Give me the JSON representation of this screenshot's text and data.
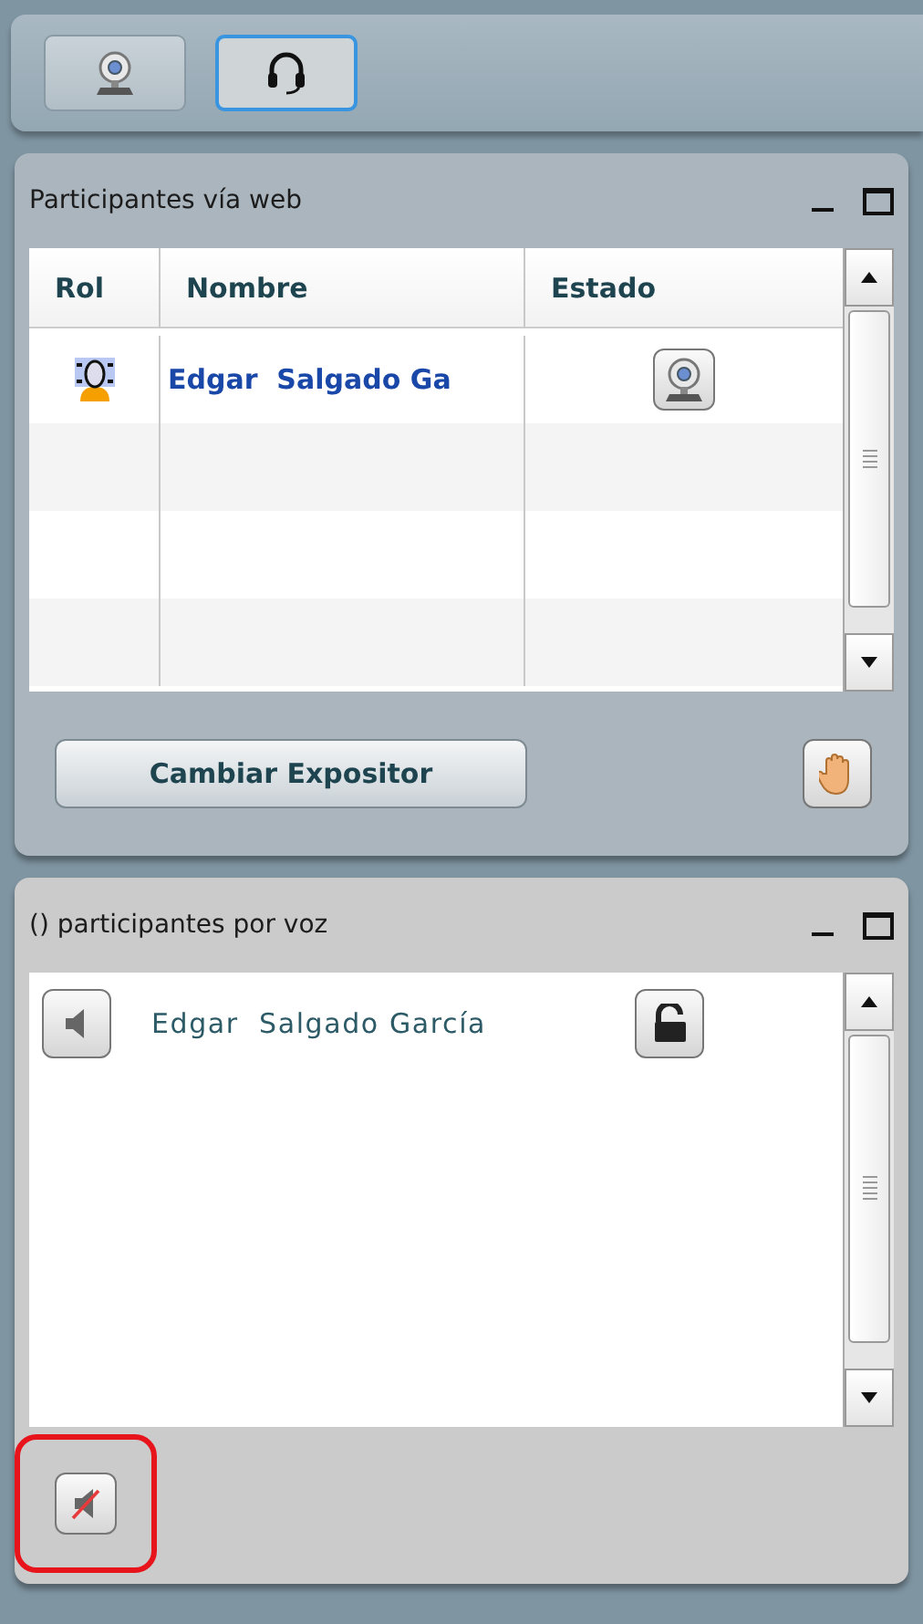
{
  "toolbar": {
    "tabs": [
      {
        "kind": "webcam",
        "selected": false
      },
      {
        "kind": "headset",
        "selected": true
      }
    ]
  },
  "web_panel": {
    "title": "Participantes vía web",
    "table": {
      "columns": [
        "Rol",
        "Nombre",
        "Estado"
      ],
      "rows": [
        {
          "name": "Edgar  Salgado Ga"
        }
      ]
    },
    "button": "Cambiar Expositor"
  },
  "voice_panel": {
    "title": "() participantes por voz",
    "participants": [
      {
        "name": "Edgar  Salgado García"
      }
    ]
  }
}
